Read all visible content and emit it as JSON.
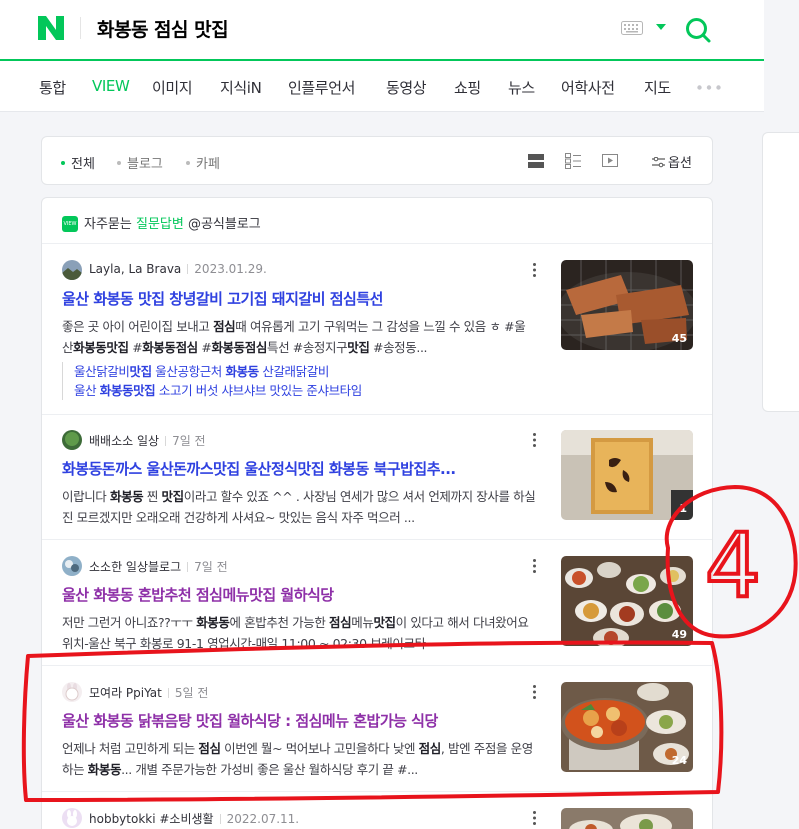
{
  "header": {
    "query": "화봉동 점심 맛집"
  },
  "tabs": [
    "통합",
    "VIEW",
    "이미지",
    "지식iN",
    "인플루언서",
    "동영상",
    "쇼핑",
    "뉴스",
    "어학사전",
    "지도"
  ],
  "filter": {
    "tabs": [
      "전체",
      "블로그",
      "카페"
    ],
    "options_label": "옵션"
  },
  "faq": {
    "icon_text": "VIEW",
    "prefix": "자주묻는 ",
    "highlight": "질문답변",
    "suffix": " @공식블로그"
  },
  "results": [
    {
      "author": "Layla, La Brava",
      "date": "2023.01.29.",
      "title": "울산 화봉동 맛집 창녕갈비 고기집 돼지갈비 점심특선",
      "desc_html": "좋은 곳 아이 어린이집 보내고 <b>점심</b>때 여유롭게 고기 구워먹는 그 감성을 느낄 수 있음 ㅎ #울산<b>화봉동맛집</b> #<b>화봉동점심</b> #<b>화봉동점심</b>특선 #송정지구<b>맛집</b> #송정동...",
      "sub_html": [
        "울산닭갈비<b>맛집</b> 울산공항근처 <b>화봉동</b> 산갈래닭갈비",
        "울산 <b>화봉동맛집</b> 소고기 버섯 샤브샤브 맛있는 준샤브타임"
      ],
      "count": "45"
    },
    {
      "author": "배배소소 일상",
      "date": "7일 전",
      "title": "화봉동돈까스 울산돈까스맛집 울산정식맛집 화봉동 북구밥집추...",
      "desc_html": "이랍니다 <b>화봉동</b> 찐 <b>맛집</b>이라고 할수 있죠 ^^ . 사장님 연세가 많으 셔서 언제까지 장사를 하실진 모르겠지만 오래오래 건강하게 사셔요~ 맛있는 음식 자주 먹으러 ...",
      "count": "1"
    },
    {
      "author": "소소한 일상블로그",
      "date": "7일 전",
      "title": "울산 화봉동 혼밥추천 점심메뉴맛집 월하식당",
      "desc_html": "저만 그런거 아니죠??ㅜㅜ <b>화봉동</b>에 혼밥추천 가능한 <b>점심</b>메뉴<b>맛집</b>이 있다고 해서 다녀왔어요 위치-울산 북구 화봉로 91-1 영업시간-매일 11:00 ~ 02:30 브레이크타",
      "count": "49"
    },
    {
      "author": "모여라 PpiYat",
      "date": "5일 전",
      "title": "울산 화봉동 닭볶음탕 맛집 월하식당 : 점심메뉴 혼밥가능 식당",
      "desc_html": "언제나 처럼 고민하게 되는 <b>점심</b> 이번엔 뭘~ 먹어보나 고민을하다 낮엔 <b>점심</b>, 밤엔 주점을 운영하는 <b>화봉동</b>... 개별 주문가능한 가성비 좋은 울산 월하식당 후기 끝 #...",
      "count": "24"
    },
    {
      "author": "hobbytokki #소비생활",
      "date": "2022.07.11."
    }
  ],
  "annotation_label": "4",
  "colors": {
    "accent": "#03c75a",
    "link": "#2f41e0",
    "visited": "#8e30a8",
    "annotation": "#e8141c"
  }
}
